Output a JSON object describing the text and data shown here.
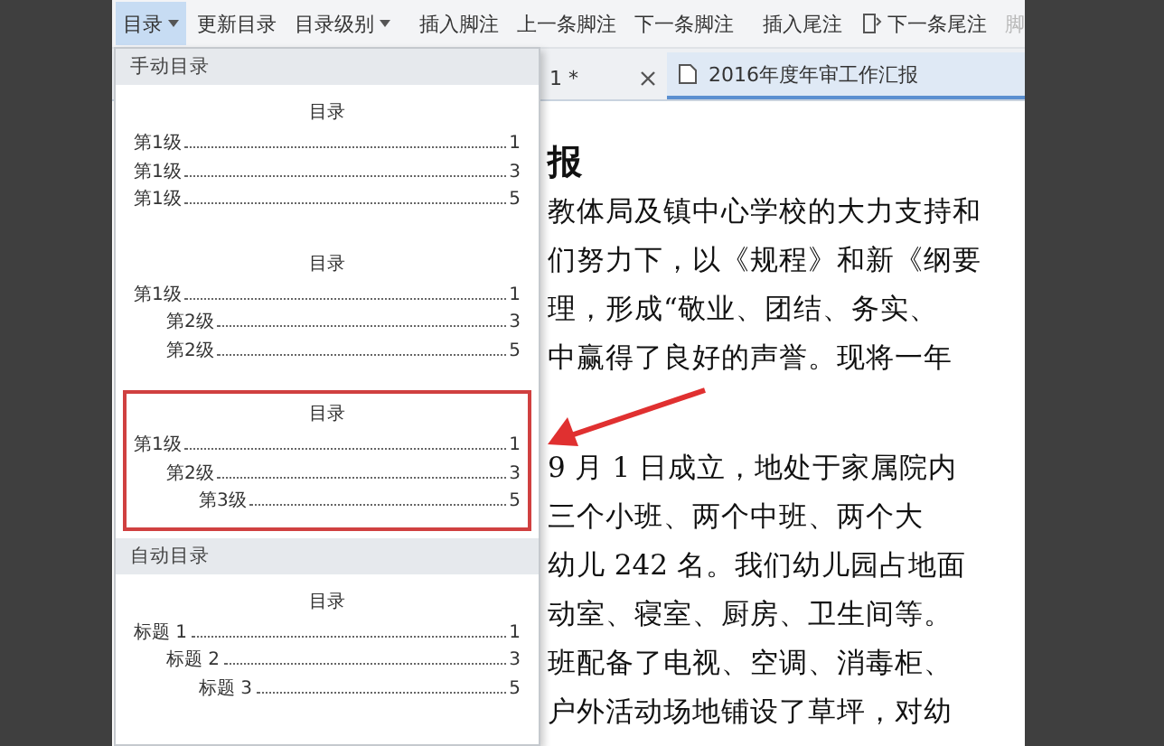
{
  "toolbar": {
    "items": [
      {
        "label": "目录",
        "dropdown": true,
        "selected": true,
        "disabled": false,
        "icon": false
      },
      {
        "label": "更新目录",
        "dropdown": false,
        "selected": false,
        "disabled": false,
        "icon": false
      },
      {
        "label": "目录级别",
        "dropdown": true,
        "selected": false,
        "disabled": false,
        "icon": false
      },
      {
        "label": "插入脚注",
        "dropdown": false,
        "selected": false,
        "disabled": false,
        "icon": false
      },
      {
        "label": "上一条脚注",
        "dropdown": false,
        "selected": false,
        "disabled": false,
        "icon": false
      },
      {
        "label": "下一条脚注",
        "dropdown": false,
        "selected": false,
        "disabled": false,
        "icon": false
      },
      {
        "label": "插入尾注",
        "dropdown": false,
        "selected": false,
        "disabled": false,
        "icon": false
      },
      {
        "label": "下一条尾注",
        "dropdown": false,
        "selected": false,
        "disabled": false,
        "icon": true
      },
      {
        "label": "脚",
        "dropdown": false,
        "selected": false,
        "disabled": true,
        "icon": false
      }
    ]
  },
  "doc_tabs": [
    {
      "label": "1 *",
      "selected": false,
      "closable": true
    },
    {
      "label": "2016年度年审工作汇报",
      "selected": true,
      "closable": false
    }
  ],
  "menu": {
    "sections": [
      {
        "header": "手动目录",
        "options": [
          {
            "title": "目录",
            "highlighted": false,
            "entries": [
              {
                "label": "第1级",
                "page": "1"
              },
              {
                "label": "第1级",
                "page": "3"
              },
              {
                "label": "第1级",
                "page": "5"
              }
            ]
          },
          {
            "title": "目录",
            "highlighted": false,
            "entries": [
              {
                "label": "第1级",
                "page": "1",
                "children": [
                  {
                    "label": "第2级",
                    "page": "3"
                  },
                  {
                    "label": "第2级",
                    "page": "5"
                  }
                ]
              }
            ]
          },
          {
            "title": "目录",
            "highlighted": true,
            "entries": [
              {
                "label": "第1级",
                "page": "1",
                "children": [
                  {
                    "label": "第2级",
                    "page": "3",
                    "children": [
                      {
                        "label": "第3级",
                        "page": "5"
                      }
                    ]
                  }
                ]
              }
            ]
          }
        ]
      },
      {
        "header": "自动目录",
        "options": [
          {
            "title": "目录",
            "highlighted": false,
            "entries": [
              {
                "label": "标题 1",
                "page": "1",
                "children": [
                  {
                    "label": "标题 2",
                    "page": "3",
                    "children": [
                      {
                        "label": "标题 3",
                        "page": "5"
                      }
                    ]
                  }
                ]
              }
            ]
          }
        ]
      }
    ]
  },
  "document": {
    "heading": "报",
    "paragraphs": [
      [
        "教体局及镇中心学校的大力支持和",
        "们努力下，以《规程》和新《纲要",
        "理，形成“敬业、团结、务实、",
        "中赢得了良好的声誉。现将一年"
      ],
      [
        "9 月 1 日成立，地处于家属院内",
        "三个小班、两个中班、两个大",
        "幼儿 242 名。我们幼儿园占地面",
        "动室、寝室、厨房、卫生间等。",
        "班配备了电视、空调、消毒柜、",
        "户外活动场地铺设了草坪，对幼"
      ]
    ]
  }
}
